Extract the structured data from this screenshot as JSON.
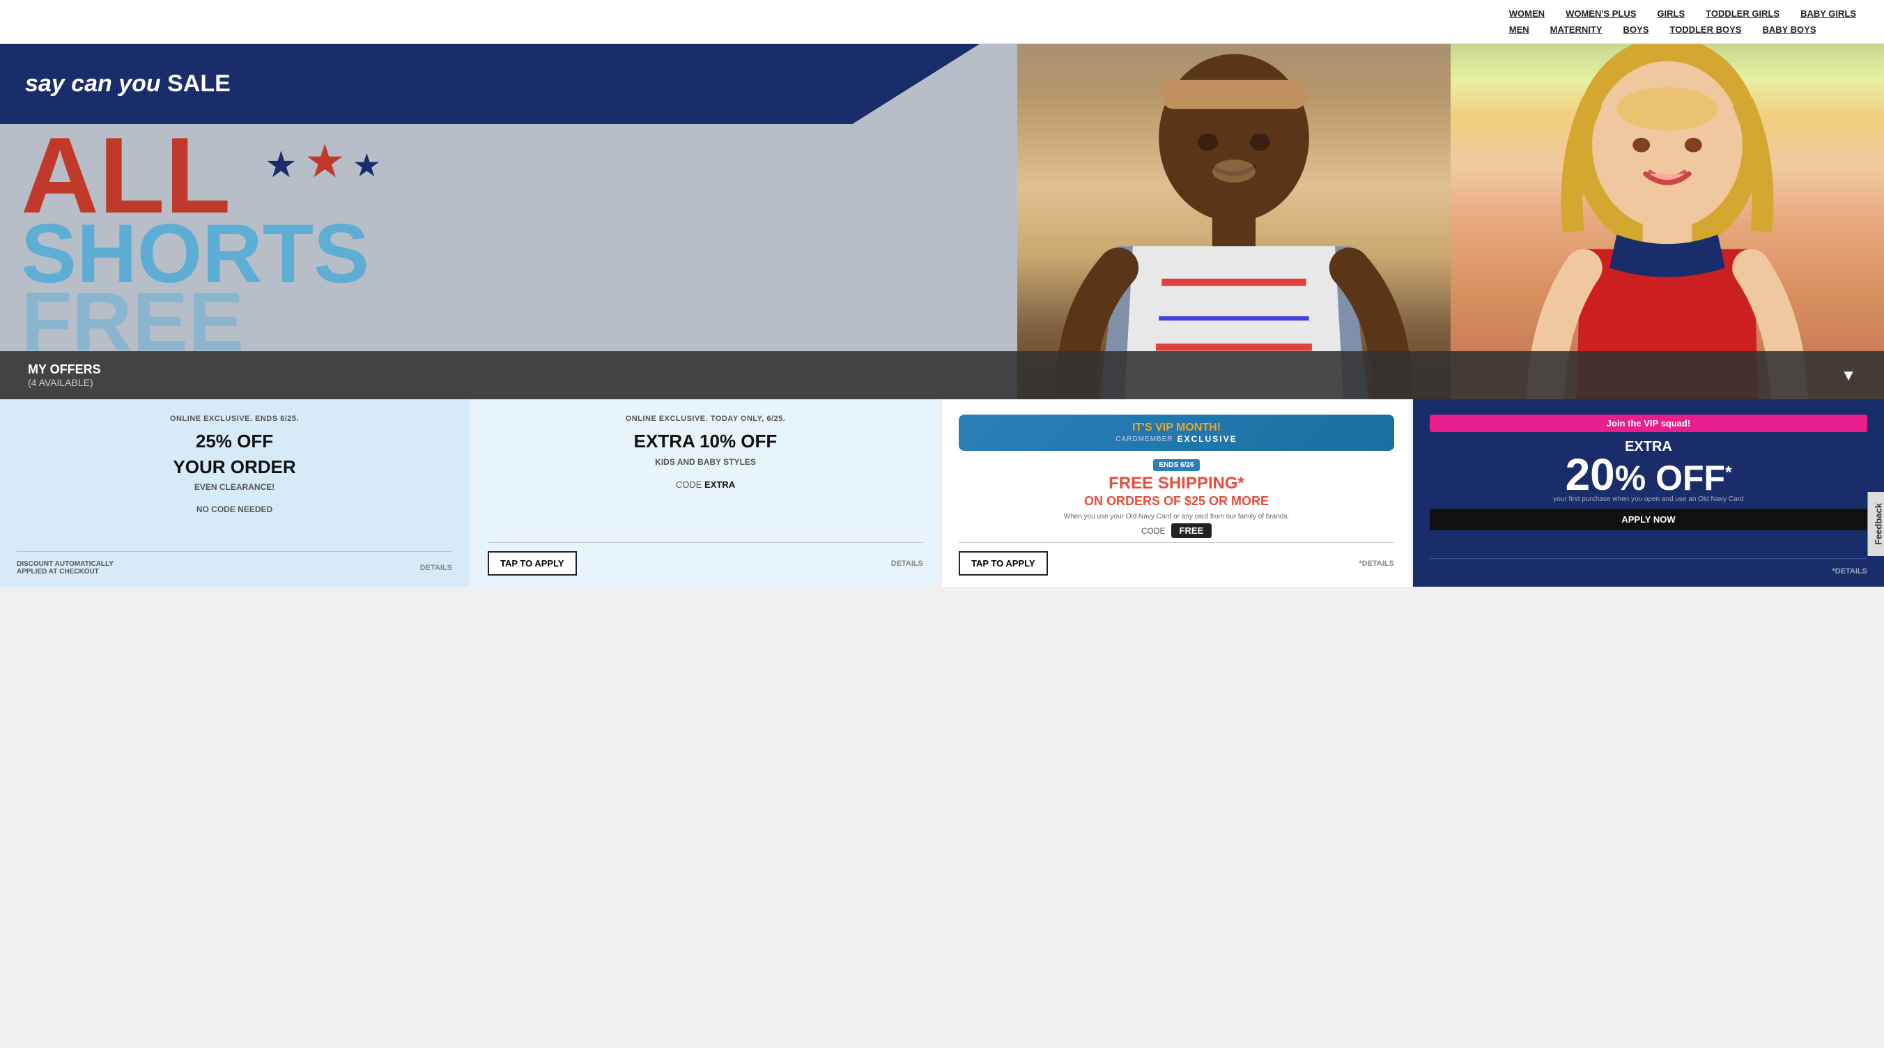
{
  "nav": {
    "row1": [
      {
        "label": "WOMEN",
        "id": "women"
      },
      {
        "label": "WOMEN'S PLUS",
        "id": "womens-plus"
      },
      {
        "label": "GIRLS",
        "id": "girls"
      },
      {
        "label": "TODDLER GIRLS",
        "id": "toddler-girls"
      },
      {
        "label": "BABY GIRLS",
        "id": "baby-girls"
      }
    ],
    "row2": [
      {
        "label": "MEN",
        "id": "men"
      },
      {
        "label": "MATERNITY",
        "id": "maternity"
      },
      {
        "label": "BOYS",
        "id": "boys"
      },
      {
        "label": "TODDLER BOYS",
        "id": "toddler-boys"
      },
      {
        "label": "BABY BOYS",
        "id": "baby-boys"
      }
    ]
  },
  "hero": {
    "say_can_you_sale": "say can you",
    "sale_word": "SALE",
    "big_all": "ALL",
    "big_shorts": "SHORTS",
    "big_free": "FREE"
  },
  "my_offers": {
    "label": "MY OFFERS",
    "count": "(4 AVAILABLE)"
  },
  "cards": [
    {
      "id": "card1",
      "subtitle": "ONLINE EXCLUSIVE. ENDS 6/25.",
      "main_line1": "25% OFF",
      "main_line2": "YOUR ORDER",
      "sub": "EVEN CLEARANCE!",
      "code_label": "NO CODE NEEDED",
      "footer_left": "DISCOUNT AUTOMATICALLY\nAPPLIED AT CHECKOUT",
      "footer_right": "DETAILS",
      "has_tap": false,
      "bg": "card-1"
    },
    {
      "id": "card2",
      "subtitle": "ONLINE EXCLUSIVE. TODAY ONLY, 6/25.",
      "main_line1": "EXTRA 10% OFF",
      "main_line2": "KIDS AND BABY STYLES",
      "code_prefix": "CODE ",
      "code_value": "EXTRA",
      "footer_right": "DETAILS",
      "has_tap": true,
      "tap_label": "TAP TO APPLY",
      "bg": "card-2"
    },
    {
      "id": "card3",
      "vip_month_label": "IT'S VIP MONTH!",
      "cardmember_label": "CARDMEMBER",
      "exclusive_label": "EXCLUSIVE",
      "ends_label": "ENDS 6/26",
      "free_ship_line1": "FREE SHIPPING*",
      "free_ship_line2": "ON ORDERS OF $25 OR MORE",
      "when_text": "When you use your Old Navy Card\nor any card from our family of brands.",
      "code_label": "CODE",
      "code_value": "FREE",
      "footer_right": "*DETAILS",
      "has_tap": true,
      "tap_label": "TAP TO APPLY",
      "bg": "card-3"
    },
    {
      "id": "card4",
      "join_vip_label": "Join the VIP squad!",
      "extra_label": "EXTRA",
      "big_number": "20",
      "off_label": "% OFF",
      "asterisk": "*",
      "fine_print": "your first purchase when you open and use an Old Navy Card",
      "apply_now": "APPLY NOW",
      "footer_right": "*DETAILS",
      "has_tap": false,
      "bg": "card-4"
    }
  ],
  "feedback": {
    "label": "Feedback"
  }
}
